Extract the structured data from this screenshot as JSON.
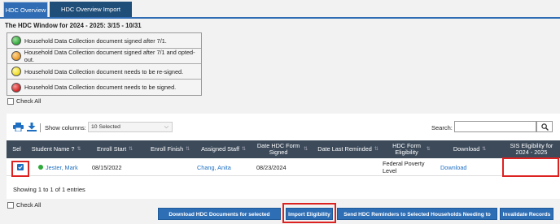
{
  "tabs": [
    {
      "label": "HDC Overview",
      "active": true
    },
    {
      "label": "HDC Overview Import Snapshot",
      "active": false
    }
  ],
  "page_title": "The HDC Window for 2024 - 2025: 3/15 - 10/31",
  "legend": [
    {
      "color": "#3cb043",
      "icon": "green-status-icon",
      "label": "Household Data Collection document signed after 7/1."
    },
    {
      "color": "#f0a030",
      "icon": "orange-status-icon",
      "label": "Household Data Collection document signed after 7/1 and opted-out."
    },
    {
      "color": "#f2e030",
      "icon": "yellow-status-icon",
      "label": "Household Data Collection document needs to be re-signed."
    },
    {
      "color": "#d83030",
      "icon": "red-status-icon",
      "label": "Household Data Collection document needs to be signed."
    }
  ],
  "check_all_label": "Check All",
  "toolbar": {
    "show_columns_label": "Show columns:",
    "show_columns_value": "10 Selected",
    "search_label": "Search:",
    "search_value": ""
  },
  "table": {
    "headers": [
      "Sel",
      "Student Name ?",
      "Enroll Start",
      "Enroll Finish",
      "Assigned Staff",
      "Date HDC Form Signed",
      "Date Last Reminded",
      "HDC Form Eligibility",
      "Download",
      "SIS Eligibility for 2024 - 2025"
    ],
    "rows": [
      {
        "selected": true,
        "status_color": "#2eaa3a",
        "student_name": "Jester, Mark",
        "enroll_start": "08/15/2022",
        "enroll_finish": "",
        "assigned_staff": "Chang, Anita",
        "date_signed": "08/23/2024",
        "date_last_reminded": "",
        "eligibility": "Federal Poverty Level",
        "download": "Download",
        "sis_eligibility": ""
      }
    ]
  },
  "showing_text": "Showing 1 to 1 of 1 entries",
  "buttons": {
    "download_docs": "Download HDC Documents for selected students",
    "import_eligibility": "Import Eligibility",
    "send_reminders": "Send HDC Reminders to Selected Households Needing to Update",
    "invalidate_records": "Invalidate Records"
  },
  "accent_color": "#2e6eb5",
  "highlight_color": "#d22222"
}
